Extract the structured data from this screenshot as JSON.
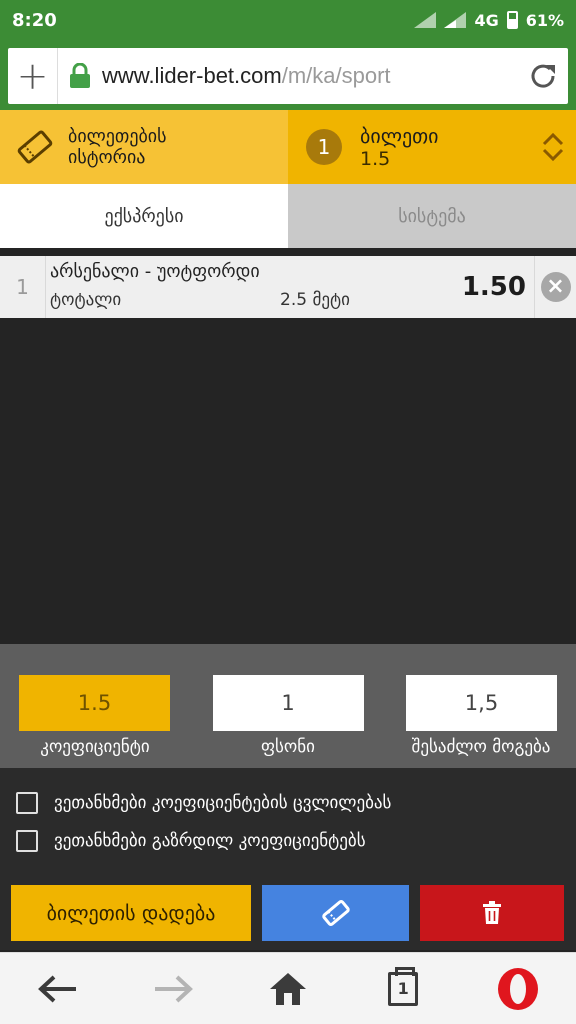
{
  "status_bar": {
    "time": "8:20",
    "network": "4G",
    "battery": "61%"
  },
  "browser": {
    "url_host": "www.lider-bet.com",
    "url_path": "/m/ka/sport"
  },
  "ticket_header": {
    "history_label_line1": "ბილეთების",
    "history_label_line2": "ისტორია",
    "ticket_count": "1",
    "ticket_label": "ბილეთი",
    "ticket_odds": "1.5"
  },
  "tabs": [
    {
      "label": "ექსპრესი",
      "active": true
    },
    {
      "label": "სისტემა",
      "active": false
    }
  ],
  "bets": [
    {
      "index": "1",
      "match": "არსენალი - უოტფორდი",
      "market": "ტოტალი",
      "selection": "2.5 მეტი",
      "odd": "1.50"
    }
  ],
  "stake_panel": {
    "coefficient_value": "1.5",
    "stake_value": "1",
    "possible_win_value": "1,5",
    "coefficient_label": "კოეფიციენტი",
    "stake_label": "ფსონი",
    "possible_win_label": "შესაძლო მოგება"
  },
  "checkboxes": [
    {
      "label": "ვეთანხმები კოეფიციენტების ცვლილებას",
      "checked": false
    },
    {
      "label": "ვეთანხმები გაზრდილ კოეფიციენტებს",
      "checked": false
    }
  ],
  "actions": {
    "place_bet_label": "ბილეთის დადება"
  },
  "navigation": {
    "tab_count": "1"
  },
  "colors": {
    "accent": "#f0b400",
    "green": "#3c8c35",
    "blue": "#4583e0",
    "red": "#c8161b"
  }
}
